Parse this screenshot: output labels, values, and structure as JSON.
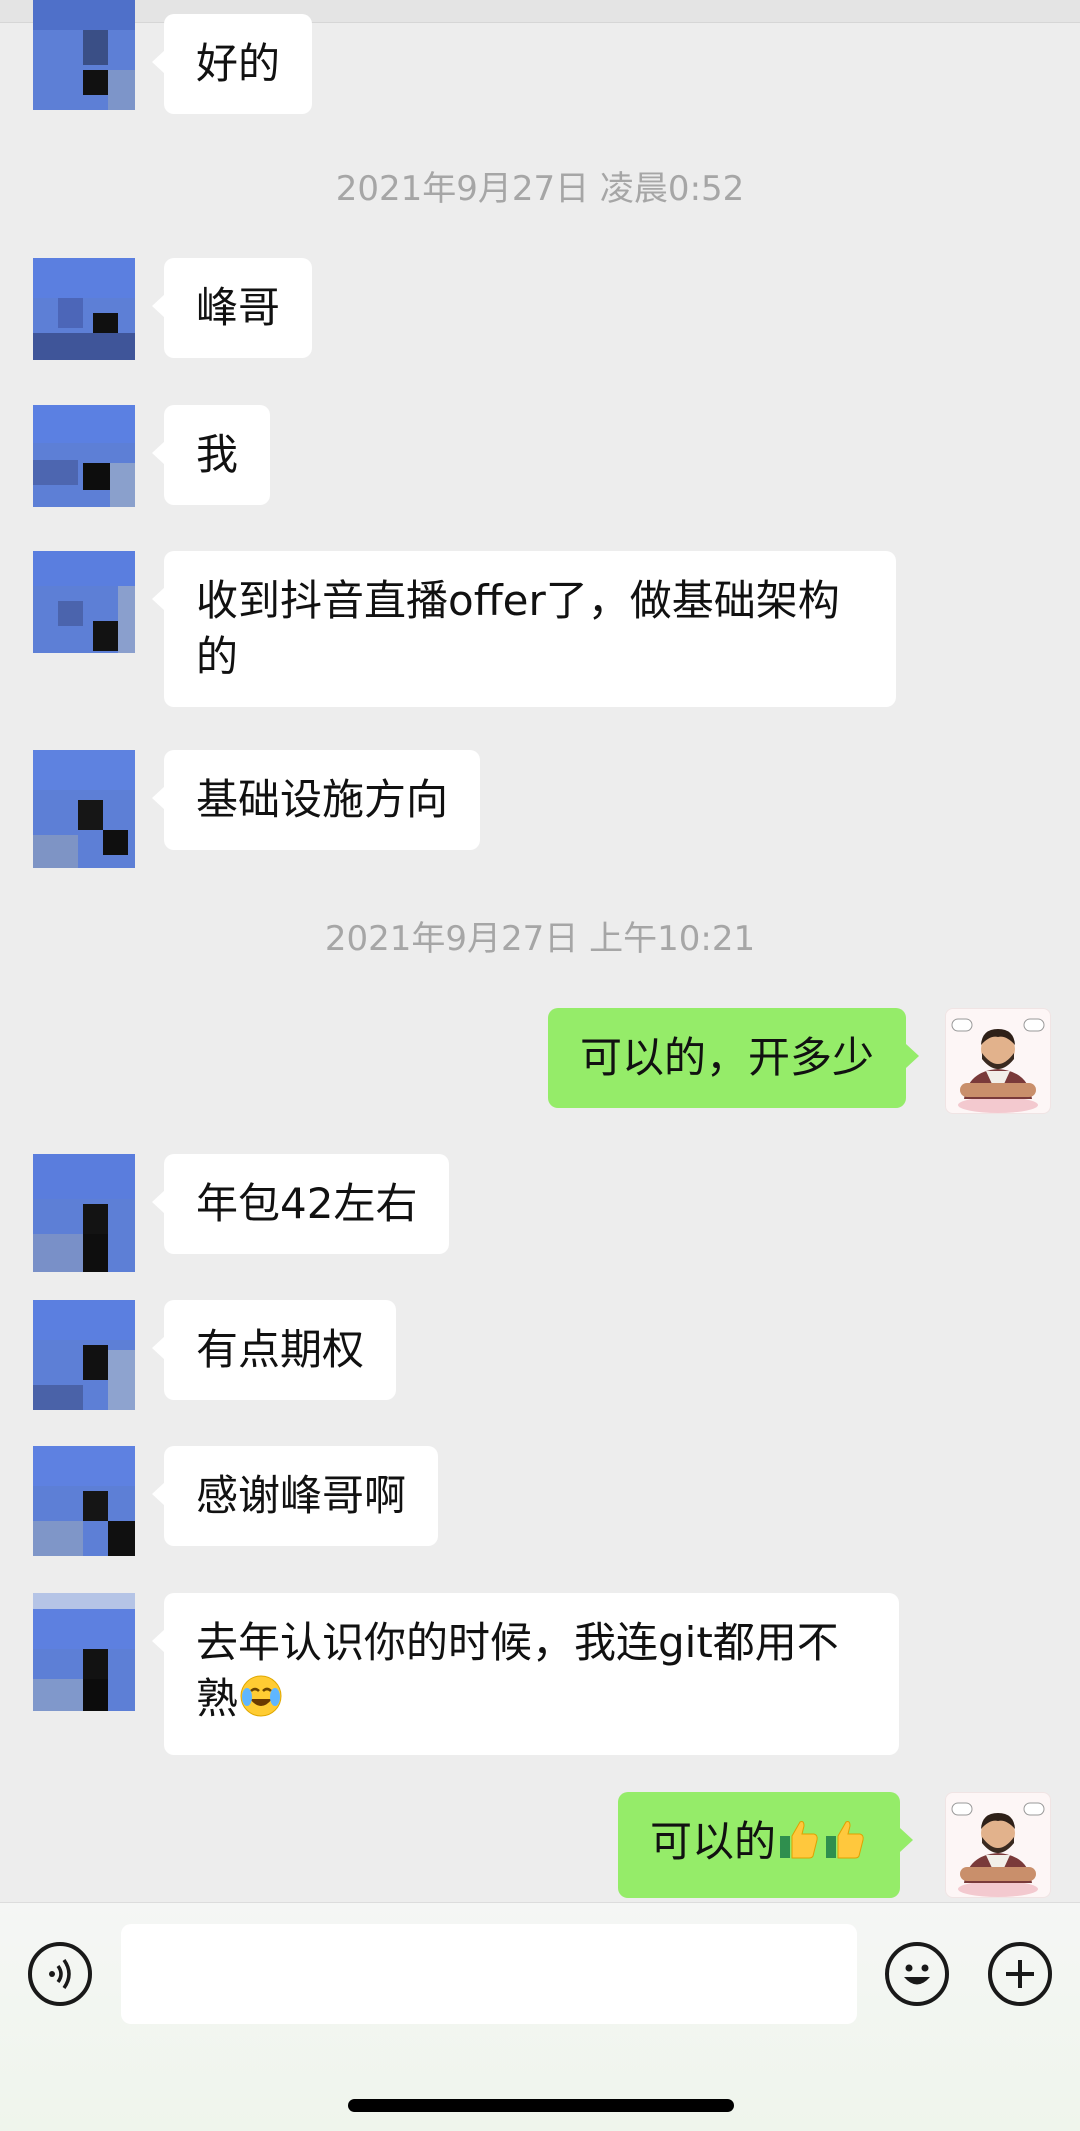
{
  "timestamps": [
    "2021年9月27日 凌晨0:52",
    "2021年9月27日 上午10:21"
  ],
  "messages": [
    {
      "from": "them",
      "text": "好的"
    },
    {
      "from": "them",
      "text": "峰哥"
    },
    {
      "from": "them",
      "text": "我"
    },
    {
      "from": "them",
      "text": "收到抖音直播offer了，做基础架构的"
    },
    {
      "from": "them",
      "text": "基础设施方向"
    },
    {
      "from": "me",
      "text": "可以的，开多少"
    },
    {
      "from": "them",
      "text": "年包42左右"
    },
    {
      "from": "them",
      "text": "有点期权"
    },
    {
      "from": "them",
      "text": "感谢峰哥啊"
    },
    {
      "from": "them",
      "text": "去年认识你的时候，我连git都用不熟",
      "emoji": "tears-of-joy"
    },
    {
      "from": "me",
      "text": "可以的",
      "emoji": "thumbs-up-x2"
    }
  ],
  "input_bar": {
    "voice_icon": "voice-icon",
    "emoji_icon": "emoji-face-icon",
    "more_icon": "plus-icon",
    "draft": ""
  },
  "colors": {
    "background": "#ededed",
    "my_bubble": "#95ec69",
    "their_bubble": "#ffffff",
    "timestamp": "#a6a6a6"
  }
}
